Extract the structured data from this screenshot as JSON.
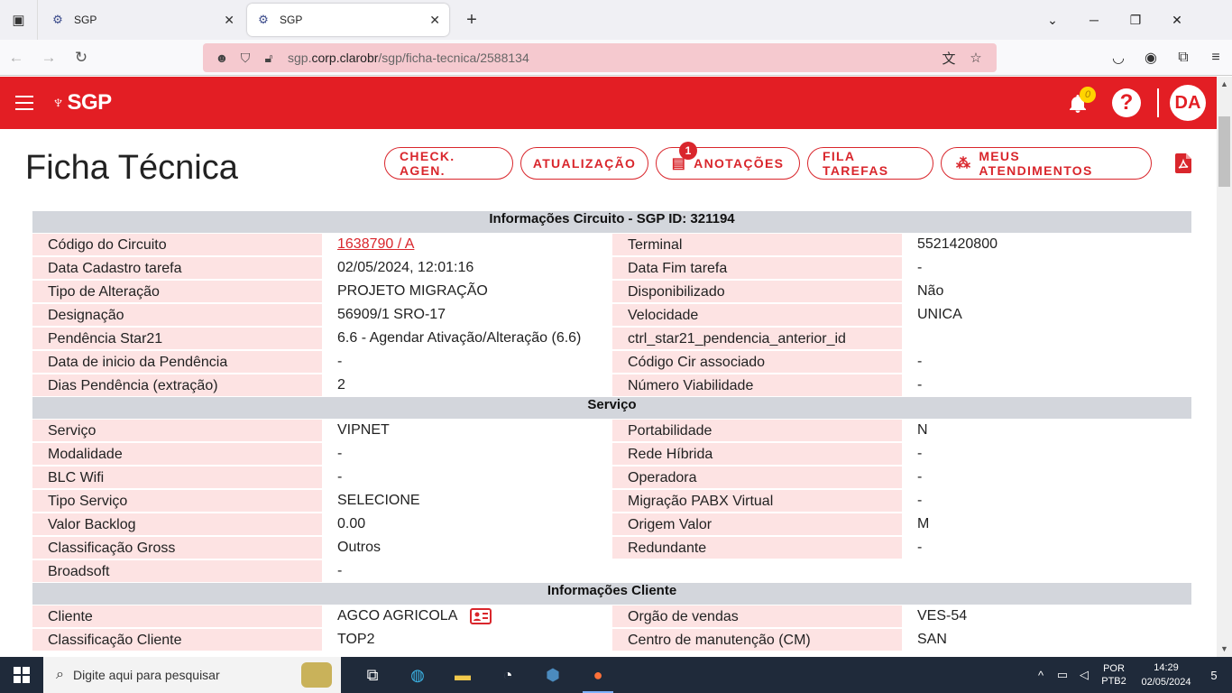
{
  "browser": {
    "tabs": [
      {
        "title": "SGP",
        "active": false
      },
      {
        "title": "SGP",
        "active": true
      }
    ],
    "url_prefix": "sgp.",
    "url_domain": "corp.clarobr",
    "url_path": "/sgp/ficha-tecnica/2588134"
  },
  "app": {
    "brand": "SGP",
    "notification_count": "0",
    "help_label": "?",
    "avatar_initials": "DA"
  },
  "page": {
    "title": "Ficha Técnica",
    "actions": {
      "check_agen": "CHECK. AGEN.",
      "atualizacao": "ATUALIZAÇÃO",
      "anotacoes": "ANOTAÇÕES",
      "anotacoes_badge": "1",
      "fila_tarefas": "FILA TAREFAS",
      "meus_atendimentos": "MEUS ATENDIMENTOS"
    }
  },
  "sections": [
    {
      "title": "Informações Circuito - SGP ID: 321194",
      "rows": [
        {
          "l1": "Código do Circuito",
          "v1": "1638790 / A",
          "l2": "Terminal",
          "v2": "5521420800"
        },
        {
          "l1": "Data Cadastro tarefa",
          "v1": "02/05/2024, 12:01:16",
          "l2": "Data Fim tarefa",
          "v2": "-"
        },
        {
          "l1": "Tipo de Alteração",
          "v1": "PROJETO MIGRAÇÃO",
          "l2": "Disponibilizado",
          "v2": "Não"
        },
        {
          "l1": "Designação",
          "v1": "56909/1 SRO-17",
          "l2": "Velocidade",
          "v2": "UNICA"
        },
        {
          "l1": "Pendência Star21",
          "v1": "6.6 - Agendar Ativação/Alteração (6.6)",
          "l2": "ctrl_star21_pendencia_anterior_id",
          "v2": ""
        },
        {
          "l1": "Data de inicio da Pendência",
          "v1": "-",
          "l2": "Código Cir associado",
          "v2": "-"
        },
        {
          "l1": "Dias Pendência (extração)",
          "v1": "2",
          "l2": "Número Viabilidade",
          "v2": "-"
        }
      ]
    },
    {
      "title": "Serviço",
      "rows": [
        {
          "l1": "Serviço",
          "v1": "VIPNET",
          "l2": "Portabilidade",
          "v2": "N"
        },
        {
          "l1": "Modalidade",
          "v1": "-",
          "l2": "Rede Híbrida",
          "v2": "-"
        },
        {
          "l1": "BLC Wifi",
          "v1": "-",
          "l2": "Operadora",
          "v2": "-"
        },
        {
          "l1": "Tipo Serviço",
          "v1": "SELECIONE",
          "l2": "Migração PABX Virtual",
          "v2": "-"
        },
        {
          "l1": "Valor Backlog",
          "v1": "0.00",
          "l2": "Origem Valor",
          "v2": "M"
        },
        {
          "l1": "Classificação Gross",
          "v1": "Outros",
          "l2": "Redundante",
          "v2": "-"
        },
        {
          "l1": "Broadsoft",
          "v1": "-",
          "l2": "",
          "v2": ""
        }
      ]
    },
    {
      "title": "Informações Cliente",
      "rows": [
        {
          "l1": "Cliente",
          "v1": "AGCO AGRICOLA",
          "l2": "Orgão de vendas",
          "v2": "VES-54"
        },
        {
          "l1": "Classificação Cliente",
          "v1": "TOP2",
          "l2": "Centro de manutenção (CM)",
          "v2": "SAN"
        }
      ]
    }
  ],
  "taskbar": {
    "search_placeholder": "Digite aqui para pesquisar",
    "lang_top": "POR",
    "lang_bottom": "PTB2",
    "time": "14:29",
    "date": "02/05/2024",
    "notif_count": "5"
  },
  "colors": {
    "brand_red": "#e31e24",
    "label_bg": "#fde3e3",
    "section_bg": "#d3d6dc"
  }
}
